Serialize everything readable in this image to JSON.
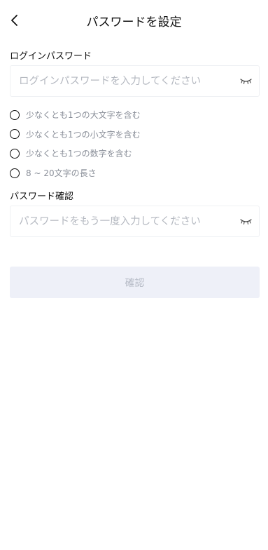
{
  "header": {
    "title": "パスワードを設定",
    "back_icon": "chevron-left-icon"
  },
  "password": {
    "label": "ログインパスワード",
    "placeholder": "ログインパスワードを入力してください",
    "eye_icon": "eye-closed-icon"
  },
  "requirements": [
    {
      "text": "少なくとも1つの大文字を含む",
      "met": false
    },
    {
      "text": "少なくとも1つの小文字を含む",
      "met": false
    },
    {
      "text": "少なくとも1つの数字を含む",
      "met": false
    },
    {
      "text": "8 ~ 20文字の長さ",
      "met": false
    }
  ],
  "confirm_password": {
    "label": "パスワード確認",
    "placeholder": "パスワードをもう一度入力してください",
    "eye_icon": "eye-closed-icon"
  },
  "submit": {
    "label": "確認",
    "enabled": false
  },
  "colors": {
    "placeholder": "#b4b8c0",
    "requirement_text": "#8a8f99",
    "button_bg_disabled": "#eef0f8",
    "button_text_disabled": "#b6bbc6"
  }
}
